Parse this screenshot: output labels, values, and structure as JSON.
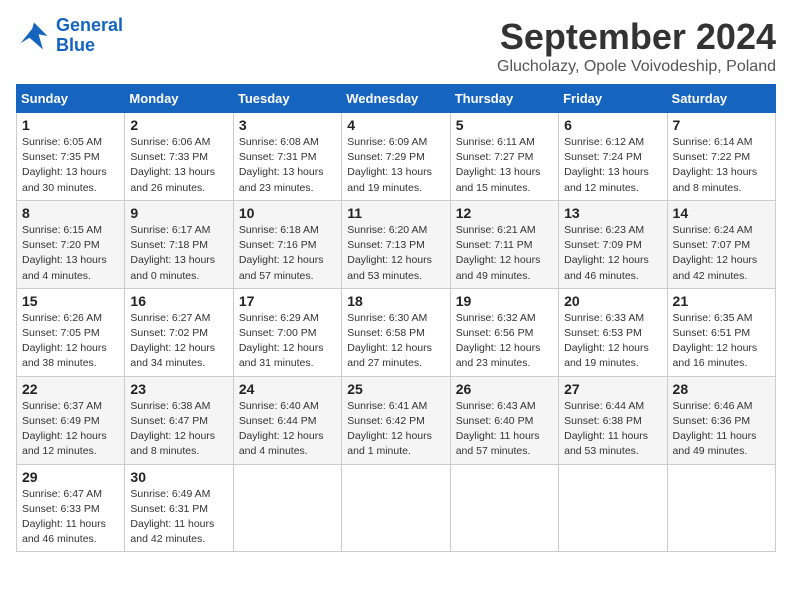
{
  "header": {
    "logo_line1": "General",
    "logo_line2": "Blue",
    "month_title": "September 2024",
    "location": "Glucholazy, Opole Voivodeship, Poland"
  },
  "weekdays": [
    "Sunday",
    "Monday",
    "Tuesday",
    "Wednesday",
    "Thursday",
    "Friday",
    "Saturday"
  ],
  "weeks": [
    [
      {
        "day": "1",
        "info": "Sunrise: 6:05 AM\nSunset: 7:35 PM\nDaylight: 13 hours\nand 30 minutes."
      },
      {
        "day": "2",
        "info": "Sunrise: 6:06 AM\nSunset: 7:33 PM\nDaylight: 13 hours\nand 26 minutes."
      },
      {
        "day": "3",
        "info": "Sunrise: 6:08 AM\nSunset: 7:31 PM\nDaylight: 13 hours\nand 23 minutes."
      },
      {
        "day": "4",
        "info": "Sunrise: 6:09 AM\nSunset: 7:29 PM\nDaylight: 13 hours\nand 19 minutes."
      },
      {
        "day": "5",
        "info": "Sunrise: 6:11 AM\nSunset: 7:27 PM\nDaylight: 13 hours\nand 15 minutes."
      },
      {
        "day": "6",
        "info": "Sunrise: 6:12 AM\nSunset: 7:24 PM\nDaylight: 13 hours\nand 12 minutes."
      },
      {
        "day": "7",
        "info": "Sunrise: 6:14 AM\nSunset: 7:22 PM\nDaylight: 13 hours\nand 8 minutes."
      }
    ],
    [
      {
        "day": "8",
        "info": "Sunrise: 6:15 AM\nSunset: 7:20 PM\nDaylight: 13 hours\nand 4 minutes."
      },
      {
        "day": "9",
        "info": "Sunrise: 6:17 AM\nSunset: 7:18 PM\nDaylight: 13 hours\nand 0 minutes."
      },
      {
        "day": "10",
        "info": "Sunrise: 6:18 AM\nSunset: 7:16 PM\nDaylight: 12 hours\nand 57 minutes."
      },
      {
        "day": "11",
        "info": "Sunrise: 6:20 AM\nSunset: 7:13 PM\nDaylight: 12 hours\nand 53 minutes."
      },
      {
        "day": "12",
        "info": "Sunrise: 6:21 AM\nSunset: 7:11 PM\nDaylight: 12 hours\nand 49 minutes."
      },
      {
        "day": "13",
        "info": "Sunrise: 6:23 AM\nSunset: 7:09 PM\nDaylight: 12 hours\nand 46 minutes."
      },
      {
        "day": "14",
        "info": "Sunrise: 6:24 AM\nSunset: 7:07 PM\nDaylight: 12 hours\nand 42 minutes."
      }
    ],
    [
      {
        "day": "15",
        "info": "Sunrise: 6:26 AM\nSunset: 7:05 PM\nDaylight: 12 hours\nand 38 minutes."
      },
      {
        "day": "16",
        "info": "Sunrise: 6:27 AM\nSunset: 7:02 PM\nDaylight: 12 hours\nand 34 minutes."
      },
      {
        "day": "17",
        "info": "Sunrise: 6:29 AM\nSunset: 7:00 PM\nDaylight: 12 hours\nand 31 minutes."
      },
      {
        "day": "18",
        "info": "Sunrise: 6:30 AM\nSunset: 6:58 PM\nDaylight: 12 hours\nand 27 minutes."
      },
      {
        "day": "19",
        "info": "Sunrise: 6:32 AM\nSunset: 6:56 PM\nDaylight: 12 hours\nand 23 minutes."
      },
      {
        "day": "20",
        "info": "Sunrise: 6:33 AM\nSunset: 6:53 PM\nDaylight: 12 hours\nand 19 minutes."
      },
      {
        "day": "21",
        "info": "Sunrise: 6:35 AM\nSunset: 6:51 PM\nDaylight: 12 hours\nand 16 minutes."
      }
    ],
    [
      {
        "day": "22",
        "info": "Sunrise: 6:37 AM\nSunset: 6:49 PM\nDaylight: 12 hours\nand 12 minutes."
      },
      {
        "day": "23",
        "info": "Sunrise: 6:38 AM\nSunset: 6:47 PM\nDaylight: 12 hours\nand 8 minutes."
      },
      {
        "day": "24",
        "info": "Sunrise: 6:40 AM\nSunset: 6:44 PM\nDaylight: 12 hours\nand 4 minutes."
      },
      {
        "day": "25",
        "info": "Sunrise: 6:41 AM\nSunset: 6:42 PM\nDaylight: 12 hours\nand 1 minute."
      },
      {
        "day": "26",
        "info": "Sunrise: 6:43 AM\nSunset: 6:40 PM\nDaylight: 11 hours\nand 57 minutes."
      },
      {
        "day": "27",
        "info": "Sunrise: 6:44 AM\nSunset: 6:38 PM\nDaylight: 11 hours\nand 53 minutes."
      },
      {
        "day": "28",
        "info": "Sunrise: 6:46 AM\nSunset: 6:36 PM\nDaylight: 11 hours\nand 49 minutes."
      }
    ],
    [
      {
        "day": "29",
        "info": "Sunrise: 6:47 AM\nSunset: 6:33 PM\nDaylight: 11 hours\nand 46 minutes."
      },
      {
        "day": "30",
        "info": "Sunrise: 6:49 AM\nSunset: 6:31 PM\nDaylight: 11 hours\nand 42 minutes."
      },
      null,
      null,
      null,
      null,
      null
    ]
  ]
}
